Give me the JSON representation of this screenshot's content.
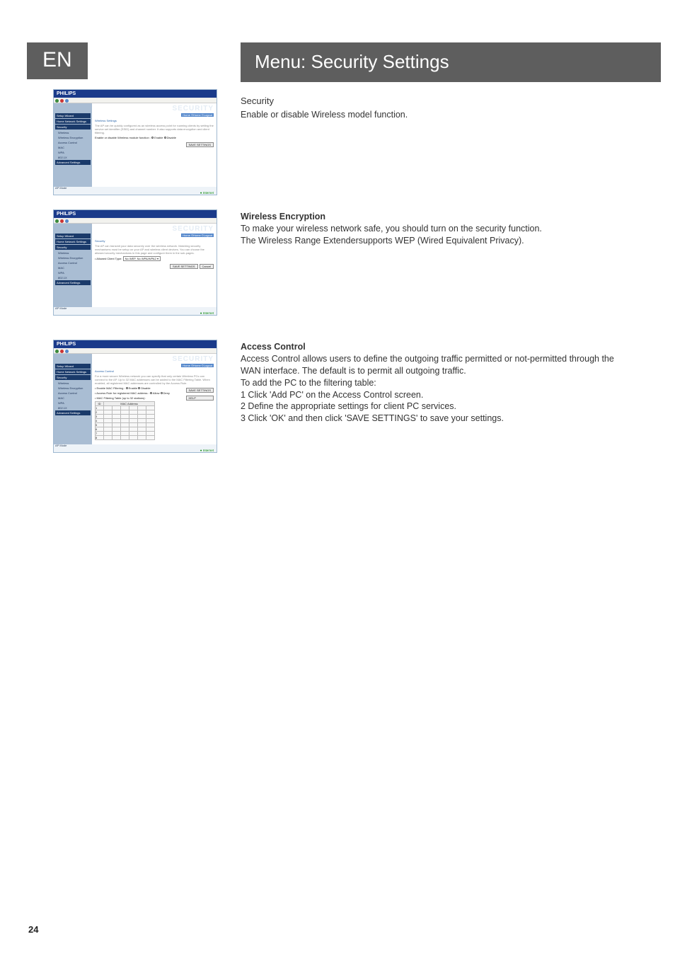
{
  "page": {
    "lang_tab": "EN",
    "title": "Menu: Security Settings",
    "number": "24"
  },
  "sections": {
    "security": {
      "heading": "Security",
      "body": "Enable or disable Wireless model function."
    },
    "wep": {
      "heading": "Wireless Encryption",
      "body1": "To make your wireless network safe, you should turn on the security function.",
      "body2": "The Wireless Range Extendersupports WEP (Wired Equivalent Privacy)."
    },
    "access": {
      "heading": "Access Control",
      "body1": "Access Control allows users to define the outgoing traffic permitted or not-permitted through the WAN interface. The default is to permit all outgoing traffic.",
      "body2": "To add the PC to the filtering table:",
      "step1": "1 Click 'Add PC' on the Access Control screen.",
      "step2": "2 Define the appropriate settings for client PC services.",
      "step3": "3 Click 'OK' and then click 'SAVE SETTINGS' to save your settings."
    }
  },
  "shot_common": {
    "brand": "PHILIPS",
    "watermark": "SECURITY",
    "crumb": "Home ©Home ©Logout",
    "side": {
      "setup_wizard": "Setup Wizard",
      "home_network": "Home Network Settings",
      "security": "Security",
      "wireless": "Wireless",
      "wenc": "Wireless Encryption",
      "acc": "Access Control",
      "mac": "MAC",
      "wpa": "WPA",
      "s8021x": "802.1X",
      "adv": "Advanced Settings"
    },
    "mode": "AP Mode",
    "footer": "Internet"
  },
  "shot1": {
    "main_h": "Wireless Settings",
    "txt": "The AP can be quickly configured as an wireless access point for roaming clients by setting the service set identifier (SSID) and channel number. It also supports data encryption and client filtering.",
    "opt_label": "Enable or disable Wireless module function :",
    "opt_enable": "Enable",
    "opt_disable": "Disable",
    "save": "SAVE SETTINGS"
  },
  "shot2": {
    "main_h": "Security",
    "txt": "The AP can transmit your data securely over the wireless network. Matching security mechanisms must be setup on your AP and wireless client devices. You can choose the allowed security mechanisms in this page and configure them in the sub-pages.",
    "label": "Allowed Client Type:",
    "select_val": "No WEP, No WPA/WPA2",
    "save": "SAVE SETTINGS",
    "cancel": "Cancel"
  },
  "shot3": {
    "main_h": "Access Control",
    "txt": "For a more secure Wireless network you can specify that only certain Wireless PCs can connect to the AP. Up to 32 MAC addresses can be added to the MAC Filtering Table. When enabled, all registered MAC addresses are controlled by the Access Rule.",
    "rule_label": "Enable MAC Filtering :",
    "rule_enable": "Enable",
    "rule_disable": "Disable",
    "acc_label": "Access Rule for registered MAC address :",
    "acc_allow": "Allow",
    "acc_deny": "Deny",
    "tbl_label": "MAC Filtering Table (up to 32 stations):",
    "col_id": "ID",
    "col_mac": "MAC Address",
    "save": "SAVE SETTINGS",
    "help": "HELP"
  }
}
